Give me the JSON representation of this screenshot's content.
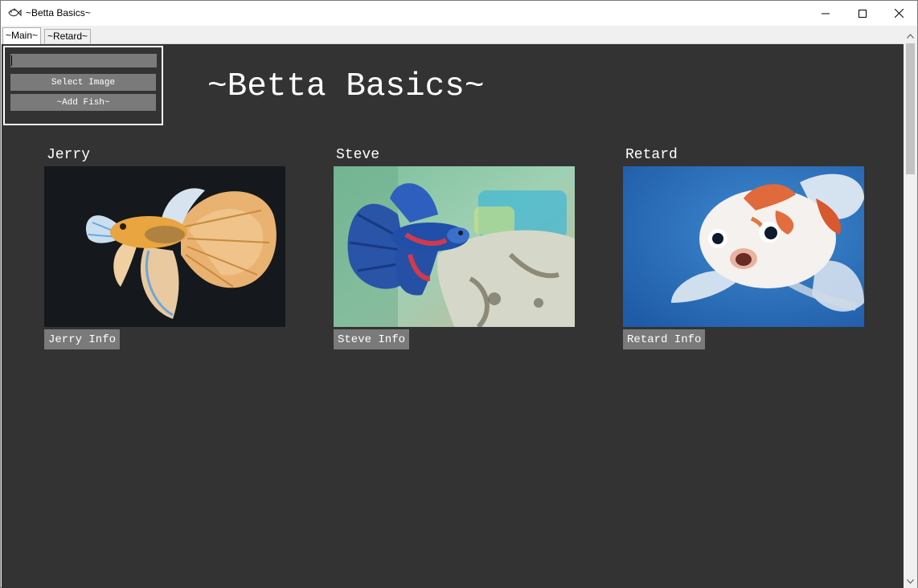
{
  "window": {
    "title": "~Betta Basics~",
    "icon": "fish-icon"
  },
  "tabs": [
    {
      "label": "~Main~",
      "active": true
    },
    {
      "label": "~Retard~",
      "active": false
    }
  ],
  "form": {
    "name_value": "",
    "select_image_label": "Select Image",
    "add_fish_label": "~Add Fish~"
  },
  "main": {
    "title": "~Betta Basics~"
  },
  "fish": [
    {
      "name": "Jerry",
      "info_label": "Jerry Info",
      "image": "orange-white-halfmoon-betta-on-black"
    },
    {
      "name": "Steve",
      "info_label": "Steve Info",
      "image": "blue-red-betta-in-aquarium"
    },
    {
      "name": "Retard",
      "info_label": "Retard Info",
      "image": "white-orange-goldfish-on-blue"
    }
  ],
  "colors": {
    "background": "#333333",
    "button": "#7a7a7a",
    "text": "#ffffff"
  }
}
